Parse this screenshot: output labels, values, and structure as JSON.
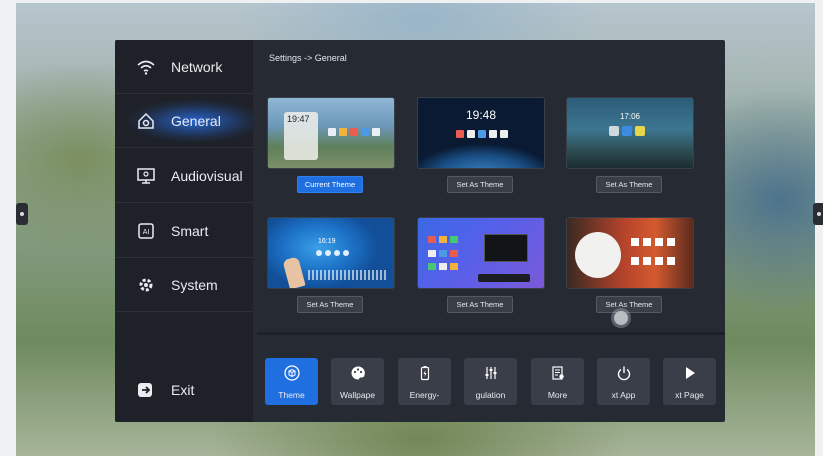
{
  "breadcrumb": "Settings -> General",
  "sidebar": {
    "items": [
      {
        "label": "Network",
        "icon": "wifi-icon"
      },
      {
        "label": "General",
        "icon": "general-settings-icon",
        "active": true
      },
      {
        "label": "Audiovisual",
        "icon": "monitor-icon"
      },
      {
        "label": "Smart",
        "icon": "ai-chip-icon"
      },
      {
        "label": "System",
        "icon": "gear-icon"
      }
    ],
    "exit_label": "Exit"
  },
  "themes": [
    {
      "button": "Current Theme",
      "clock": "19:47",
      "current": true
    },
    {
      "button": "Set As Theme",
      "clock": "19:48"
    },
    {
      "button": "Set As Theme",
      "clock": "17:06"
    },
    {
      "button": "Set As Theme",
      "clock": "16:19"
    },
    {
      "button": "Set As Theme",
      "clock": ""
    },
    {
      "button": "Set As Theme",
      "clock": ""
    }
  ],
  "toolbar": [
    {
      "label": "Theme",
      "icon": "cube-icon",
      "active": true
    },
    {
      "label": "Wallpape",
      "icon": "palette-icon"
    },
    {
      "label": "Energy-",
      "icon": "battery-icon"
    },
    {
      "label": "gulation",
      "icon": "sliders-icon"
    },
    {
      "label": "More",
      "icon": "document-icon"
    },
    {
      "label": "xt App",
      "icon": "power-icon"
    },
    {
      "label": "xt Page",
      "icon": "play-icon"
    }
  ],
  "colors": {
    "accent": "#1f6fe0",
    "panel": "#262a33",
    "sidebar": "#1e2128"
  }
}
